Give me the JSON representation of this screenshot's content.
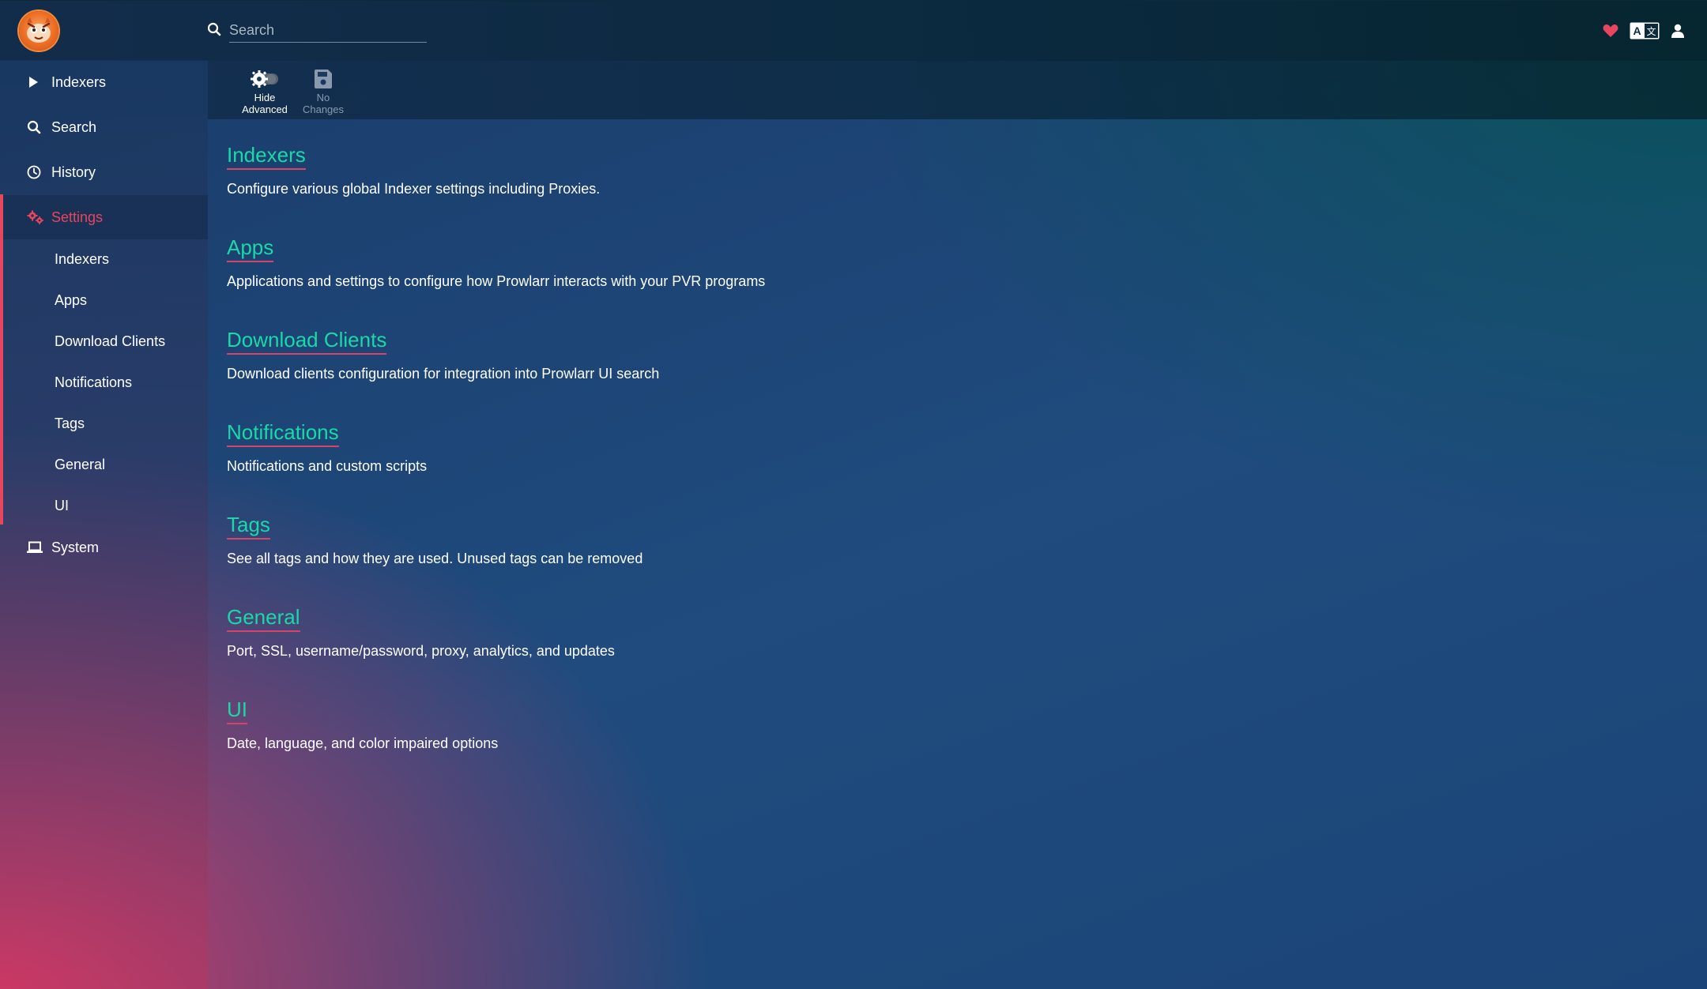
{
  "app": {
    "name": "Prowlarr"
  },
  "header": {
    "search_placeholder": "Search",
    "icons": [
      "heart-icon",
      "translate-icon",
      "user-icon"
    ],
    "heart_color": "#e8455f"
  },
  "sidebar": {
    "items": [
      {
        "label": "Indexers",
        "icon": "play-icon"
      },
      {
        "label": "Search",
        "icon": "search-icon"
      },
      {
        "label": "History",
        "icon": "clock-icon"
      },
      {
        "label": "Settings",
        "icon": "cogs-icon",
        "active": true
      },
      {
        "label": "System",
        "icon": "laptop-icon"
      }
    ],
    "settings_sub": [
      "Indexers",
      "Apps",
      "Download Clients",
      "Notifications",
      "Tags",
      "General",
      "UI"
    ],
    "accent_color": "#e8455f"
  },
  "toolbar": {
    "hide_advanced": {
      "line1": "Hide",
      "line2": "Advanced"
    },
    "no_changes": {
      "line1": "No",
      "line2": "Changes"
    }
  },
  "sections": [
    {
      "title": "Indexers",
      "desc": "Configure various global Indexer settings including Proxies."
    },
    {
      "title": "Apps",
      "desc": "Applications and settings to configure how Prowlarr interacts with your PVR programs"
    },
    {
      "title": "Download Clients",
      "desc": "Download clients configuration for integration into Prowlarr UI search"
    },
    {
      "title": "Notifications",
      "desc": "Notifications and custom scripts"
    },
    {
      "title": "Tags",
      "desc": "See all tags and how they are used. Unused tags can be removed"
    },
    {
      "title": "General",
      "desc": "Port, SSL, username/password, proxy, analytics, and updates"
    },
    {
      "title": "UI",
      "desc": "Date, language, and color impaired options"
    }
  ],
  "colors": {
    "link": "#1ad8a8",
    "link_underline": "#d7446a"
  }
}
